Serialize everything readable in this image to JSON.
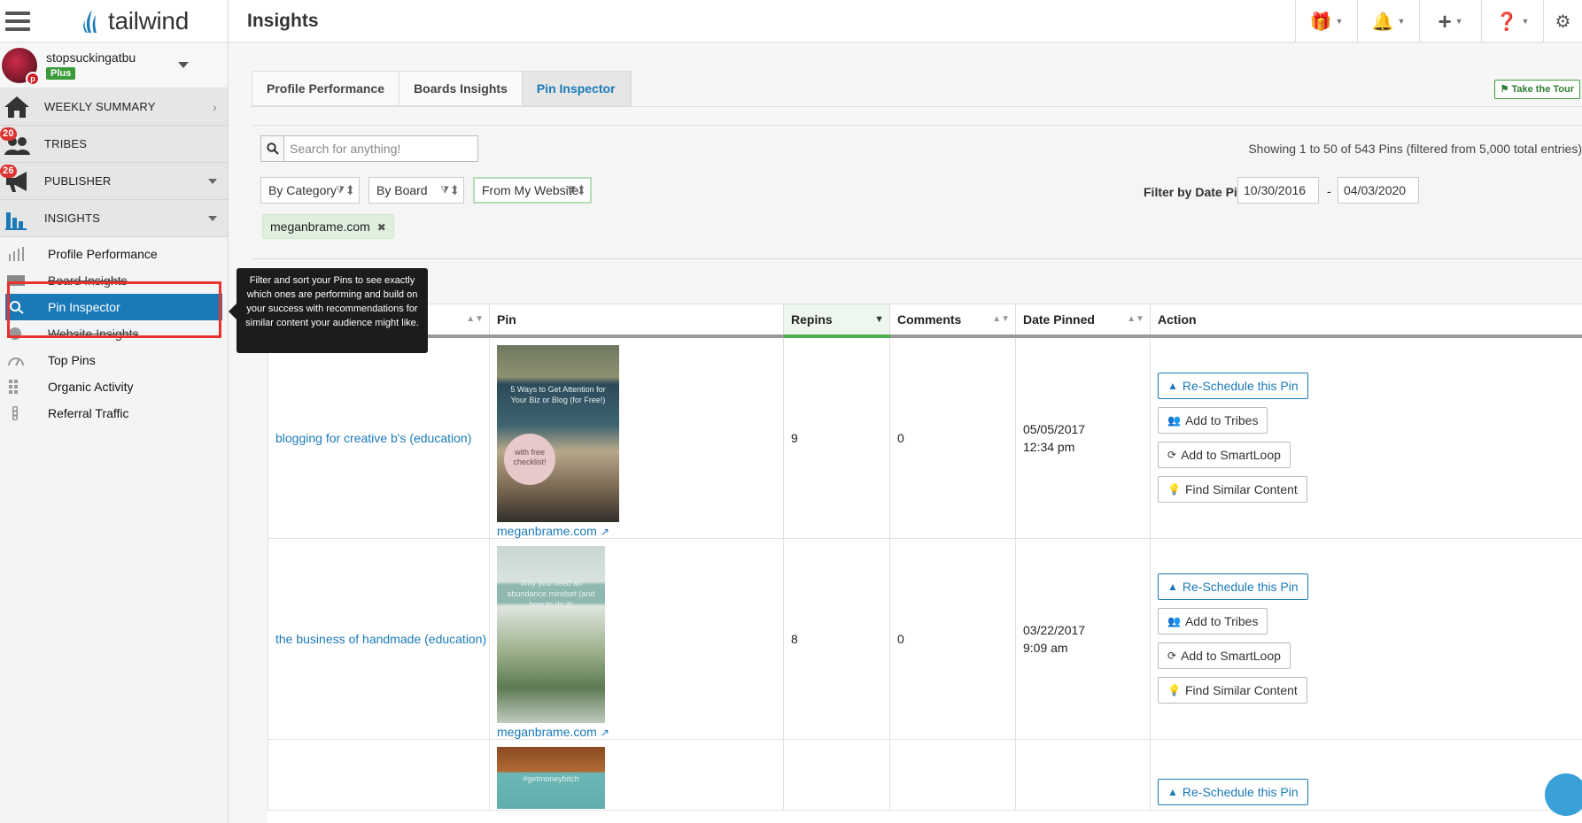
{
  "app": {
    "name": "tailwind"
  },
  "account": {
    "name": "stopsuckingatbu",
    "plan": "Plus"
  },
  "nav": {
    "sections": [
      {
        "label": "WEEKLY SUMMARY",
        "badge": "",
        "icon": "home-icon"
      },
      {
        "label": "TRIBES",
        "badge": "20",
        "icon": "tribes-icon"
      },
      {
        "label": "PUBLISHER",
        "badge": "26",
        "icon": "megaphone-icon"
      },
      {
        "label": "INSIGHTS",
        "badge": "",
        "icon": "bar-chart-icon"
      }
    ],
    "insights_items": [
      {
        "label": "Profile Performance",
        "icon": "line-chart-icon"
      },
      {
        "label": "Board Insights",
        "icon": "board-icon"
      },
      {
        "label": "Pin Inspector",
        "icon": "pin-inspector-icon"
      },
      {
        "label": "Website Insights",
        "icon": "globe-icon"
      },
      {
        "label": "Top Pins",
        "icon": "gauge-icon"
      },
      {
        "label": "Organic Activity",
        "icon": "grid-icon"
      },
      {
        "label": "Referral Traffic",
        "icon": "traffic-light-icon"
      }
    ]
  },
  "tooltip": {
    "text": "Filter and sort your Pins to see exactly which ones are performing and build on your success with recommendations for similar content your audience might like."
  },
  "header": {
    "title": "Insights"
  },
  "tabs": [
    {
      "label": "Profile Performance"
    },
    {
      "label": "Boards Insights"
    },
    {
      "label": "Pin Inspector"
    }
  ],
  "tour": {
    "label": "Take the Tour"
  },
  "search": {
    "placeholder": "Search for anything!",
    "value": ""
  },
  "showing": "Showing 1 to 50 of 543 Pins (filtered from 5,000 total entries)",
  "filters": {
    "category": "By Category",
    "board": "By Board",
    "source": "From My Website",
    "date_label": "Filter by Date Pinned:",
    "date_from": "10/30/2016",
    "date_to": "04/03/2020",
    "dash": "-",
    "chip": "meganbrame.com",
    "chip_remove": "✖"
  },
  "table": {
    "columns": [
      "Pin",
      "Repins",
      "Comments",
      "Date Pinned",
      "Action"
    ],
    "rows": [
      {
        "board": "blogging for creative b's (education)",
        "pin_text": "5 Ways to Get Attention for Your Biz or Blog (for Free!)",
        "pin_circle": "with free checklist!",
        "source": "meganbrame.com",
        "repins": "9",
        "comments": "0",
        "date": "05/05/2017",
        "time": "12:34 pm"
      },
      {
        "board": "the business of handmade (education)",
        "pin_text": "Why you need an abundance mindset (and how to do it)",
        "pin_circle": "",
        "source": "meganbrame.com",
        "repins": "8",
        "comments": "0",
        "date": "03/22/2017",
        "time": "9:09 am"
      }
    ],
    "partial_row": {
      "pin_text": "#getmoneybitch"
    },
    "actions": {
      "reschedule": "Re-Schedule this Pin",
      "tribes": "Add to Tribes",
      "smartloop": "Add to SmartLoop",
      "similar": "Find Similar Content"
    }
  },
  "colors": {
    "accent": "#1a7ab8",
    "highlight": "#e8322f",
    "green": "#3a9b3a"
  }
}
